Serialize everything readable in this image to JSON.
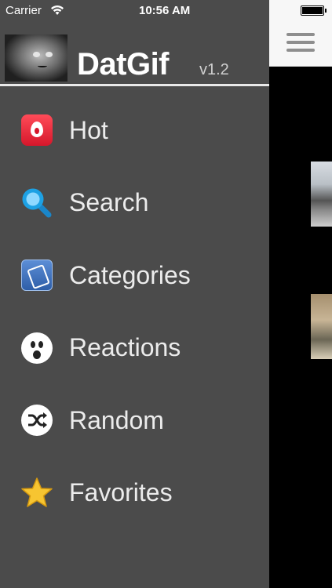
{
  "status_bar": {
    "carrier": "Carrier",
    "time": "10:56 AM"
  },
  "app": {
    "name": "DatGif",
    "version": "v1.2"
  },
  "menu": [
    {
      "label": "Hot",
      "icon": "flame-icon"
    },
    {
      "label": "Search",
      "icon": "magnifier-icon"
    },
    {
      "label": "Categories",
      "icon": "categories-icon"
    },
    {
      "label": "Reactions",
      "icon": "surprised-face-icon"
    },
    {
      "label": "Random",
      "icon": "shuffle-icon"
    },
    {
      "label": "Favorites",
      "icon": "star-icon"
    }
  ],
  "colors": {
    "drawer_bg": "#4b4b4b",
    "hot_red": "#e8283c",
    "search_blue": "#1da1e4",
    "star_yellow": "#f7c531"
  }
}
